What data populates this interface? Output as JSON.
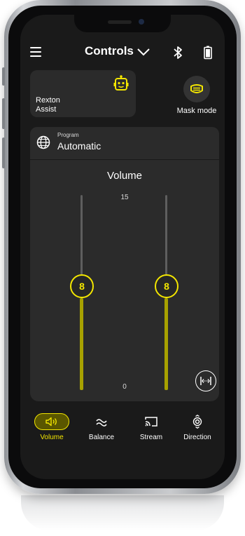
{
  "header": {
    "title": "Controls",
    "menu_icon": "hamburger-icon",
    "dropdown_icon": "chevron-down-icon",
    "bluetooth_icon": "bluetooth-icon",
    "battery_icon": "battery-icon"
  },
  "assist": {
    "label_line1": "Rexton",
    "label_line2": "Assist",
    "icon": "robot-icon"
  },
  "mask": {
    "label": "Mask mode",
    "icon": "mask-icon"
  },
  "program": {
    "caption": "Program",
    "value": "Automatic",
    "icon": "globe-icon"
  },
  "volume": {
    "title": "Volume",
    "scale_max": "15",
    "scale_min": "0",
    "left_value": "8",
    "right_value": "8",
    "max": 15,
    "min": 0,
    "link_icon": "link-sliders-icon"
  },
  "nav": {
    "items": [
      {
        "label": "Volume",
        "icon": "speaker-icon",
        "active": true
      },
      {
        "label": "Balance",
        "icon": "waves-icon",
        "active": false
      },
      {
        "label": "Stream",
        "icon": "cast-icon",
        "active": false
      },
      {
        "label": "Direction",
        "icon": "direction-icon",
        "active": false
      }
    ]
  },
  "colors": {
    "accent": "#f3e600",
    "accent_fill": "#a7a100",
    "screen_bg": "#1a1a1a",
    "card_bg": "#2b2b2b"
  }
}
